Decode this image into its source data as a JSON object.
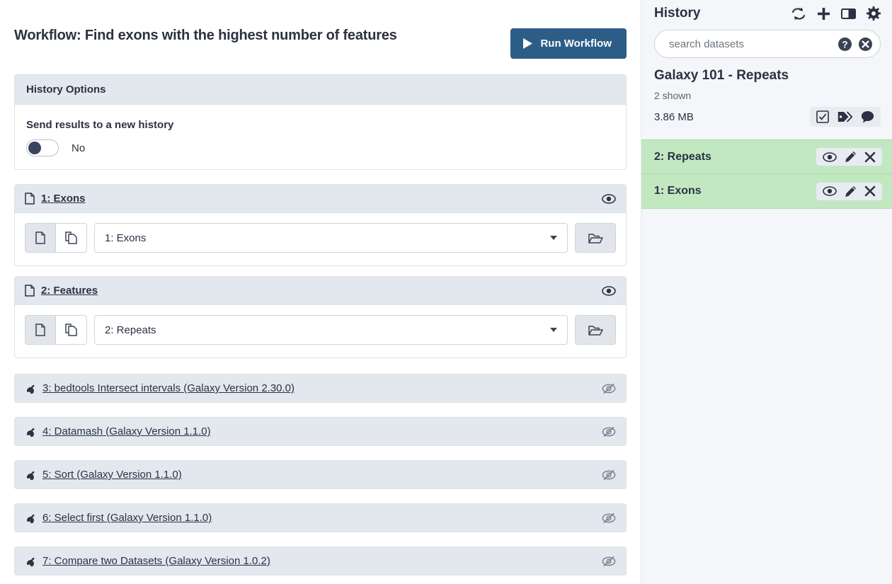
{
  "workflow": {
    "title": "Workflow: Find exons with the highest number of features",
    "run_button": "Run Workflow"
  },
  "history_options": {
    "header": "History Options",
    "send_results_label": "Send results to a new history",
    "toggle_value": "No"
  },
  "input_steps": [
    {
      "header": "1: Exons",
      "icon": "file-icon",
      "visible_icon": "eye-icon",
      "mode_single_icon": "single-dataset-icon",
      "mode_multiple_icon": "multiple-datasets-icon",
      "selected_value": "1: Exons",
      "browse_icon": "folder-open-icon"
    },
    {
      "header": "2: Features",
      "icon": "file-icon",
      "visible_icon": "eye-icon",
      "mode_single_icon": "single-dataset-icon",
      "mode_multiple_icon": "multiple-datasets-icon",
      "selected_value": "2: Repeats",
      "browse_icon": "folder-open-icon"
    }
  ],
  "tool_steps": [
    {
      "label": "3: bedtools Intersect intervals (Galaxy Version 2.30.0)",
      "icon": "wrench-icon",
      "toggle_icon": "eye-slash-icon"
    },
    {
      "label": "4: Datamash (Galaxy Version 1.1.0)",
      "icon": "wrench-icon",
      "toggle_icon": "eye-slash-icon"
    },
    {
      "label": "5: Sort (Galaxy Version 1.1.0)",
      "icon": "wrench-icon",
      "toggle_icon": "eye-slash-icon"
    },
    {
      "label": "6: Select first (Galaxy Version 1.1.0)",
      "icon": "wrench-icon",
      "toggle_icon": "eye-slash-icon"
    },
    {
      "label": "7: Compare two Datasets (Galaxy Version 1.0.2)",
      "icon": "wrench-icon",
      "toggle_icon": "eye-slash-icon"
    }
  ],
  "history_panel": {
    "title": "History",
    "header_icons": [
      "refresh-icon",
      "plus-icon",
      "columns-icon",
      "gear-icon"
    ],
    "search": {
      "placeholder": "search datasets",
      "value": "",
      "help_icon": "question-circle-icon",
      "clear_icon": "times-circle-icon"
    },
    "history_name": "Galaxy 101 - Repeats",
    "shown_count": "2 shown",
    "size": "3.86 MB",
    "meta_icons": [
      "check-square-icon",
      "tags-icon",
      "comment-icon"
    ],
    "datasets": [
      {
        "name": "2: Repeats",
        "actions": [
          "eye-icon",
          "pencil-icon",
          "times-icon"
        ]
      },
      {
        "name": "1: Exons",
        "actions": [
          "eye-icon",
          "pencil-icon",
          "times-icon"
        ]
      }
    ]
  },
  "colors": {
    "accent_blue": "#2c5d87",
    "dataset_ok_green": "#c2e8c2",
    "panel_bg": "#f4f6f9",
    "card_head": "#e2e8ee",
    "text": "#2c3143"
  }
}
